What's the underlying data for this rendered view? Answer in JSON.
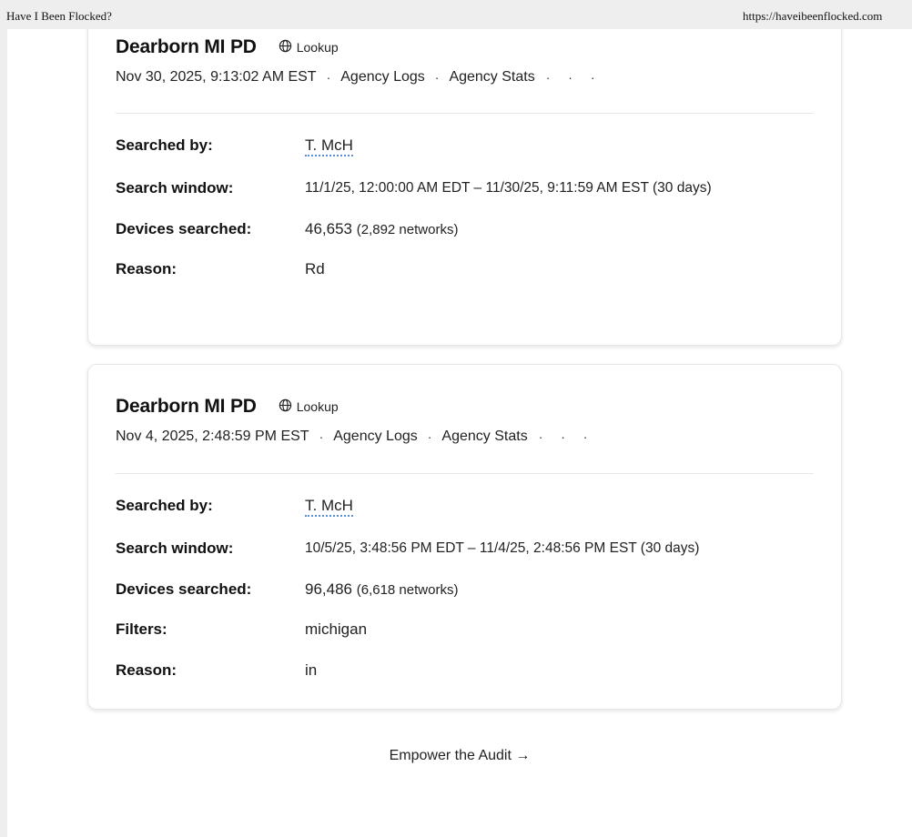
{
  "browser": {
    "page_title": "Have I Been Flocked?",
    "url": "https://haveibeenflocked.com"
  },
  "records": [
    {
      "agency": "Dearborn MI PD",
      "lookup_label": "Lookup",
      "timestamp": "Nov 30, 2025, 9:13:02 AM EST",
      "agency_logs_label": "Agency Logs",
      "agency_stats_label": "Agency Stats",
      "more": "· · ·",
      "labels": {
        "searched_by": "Searched by:",
        "search_window": "Search window:",
        "devices_searched": "Devices searched:",
        "reason": "Reason:"
      },
      "searched_by": "T. McH",
      "search_window": "11/1/25, 12:00:00 AM EDT – 11/30/25, 9:11:59 AM EST (30 days)",
      "devices_count": "46,653",
      "networks": "(2,892 networks)",
      "reason": "Rd"
    },
    {
      "agency": "Dearborn MI PD",
      "lookup_label": "Lookup",
      "timestamp": "Nov 4, 2025, 2:48:59 PM EST",
      "agency_logs_label": "Agency Logs",
      "agency_stats_label": "Agency Stats",
      "more": "· · ·",
      "labels": {
        "searched_by": "Searched by:",
        "search_window": "Search window:",
        "devices_searched": "Devices searched:",
        "filters": "Filters:",
        "reason": "Reason:"
      },
      "searched_by": "T. McH",
      "search_window": "10/5/25, 3:48:56 PM EDT – 11/4/25, 2:48:56 PM EST (30 days)",
      "devices_count": "96,486",
      "networks": "(6,618 networks)",
      "filters": "michigan",
      "reason": "in"
    }
  ],
  "footer": {
    "empower_link": "Empower the Audit →"
  },
  "icons": {
    "lookup": "globe-icon",
    "separator": "dot-separator"
  },
  "colors": {
    "user_underline": "#5a8fd8"
  }
}
